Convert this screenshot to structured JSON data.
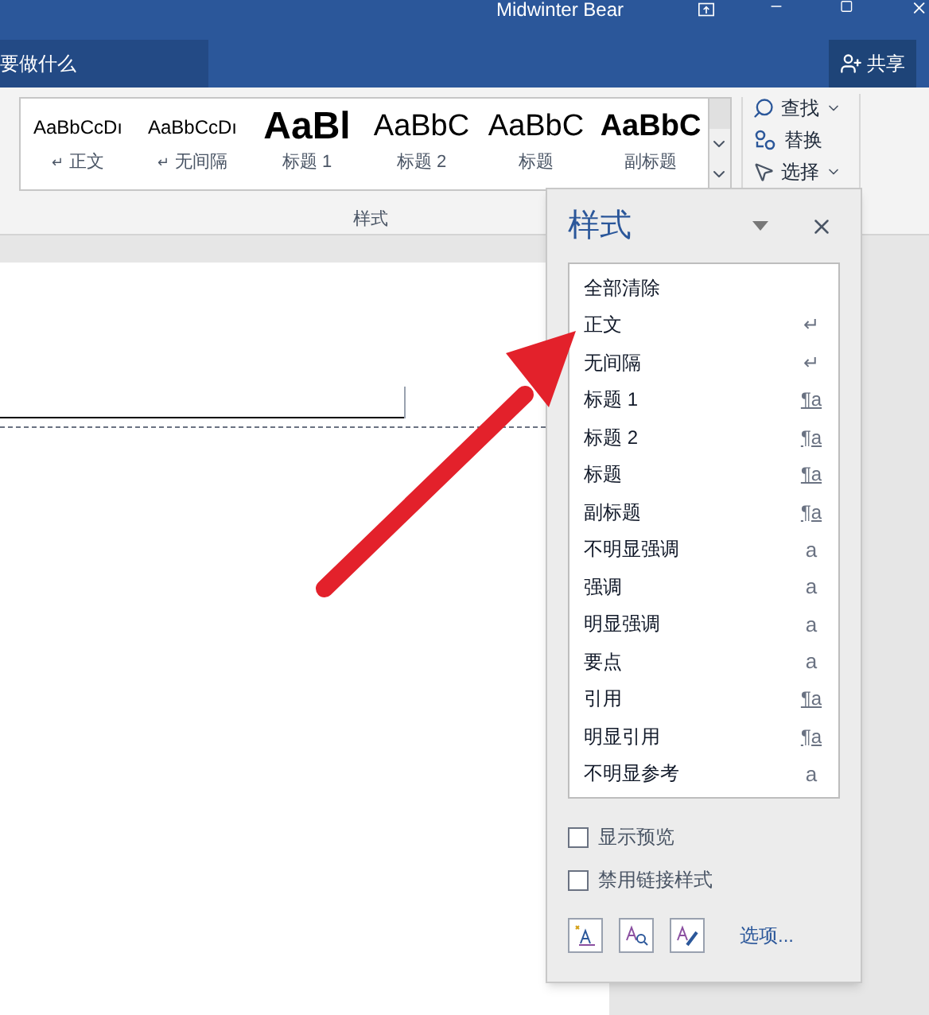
{
  "window": {
    "title": "Midwinter Bear"
  },
  "tell_me": {
    "text": "要做什么"
  },
  "share": {
    "label": "共享"
  },
  "ribbon": {
    "gallery": [
      {
        "preview": "AaBbCcDı",
        "label": "正文",
        "kind": "normal",
        "marker": "↵"
      },
      {
        "preview": "AaBbCcDı",
        "label": "无间隔",
        "kind": "normal",
        "marker": "↵"
      },
      {
        "preview": "AaBl",
        "label": "标题 1",
        "kind": "heading1"
      },
      {
        "preview": "AaBbC",
        "label": "标题 2",
        "kind": "heading2"
      },
      {
        "preview": "AaBbC",
        "label": "标题",
        "kind": "title"
      },
      {
        "preview": "AaBbC",
        "label": "副标题",
        "kind": "subtitle"
      }
    ],
    "group_label": "样式",
    "editing": [
      {
        "label": "查找",
        "kind": "find",
        "dropdown": true
      },
      {
        "label": "替换",
        "kind": "replace",
        "dropdown": false
      },
      {
        "label": "选择",
        "kind": "select",
        "dropdown": true
      }
    ]
  },
  "styles_pane": {
    "title": "样式",
    "items": [
      {
        "name": "全部清除",
        "kind": "none"
      },
      {
        "name": "正文",
        "kind": "paragraph",
        "marker": "↵"
      },
      {
        "name": "无间隔",
        "kind": "paragraph",
        "marker": "↵"
      },
      {
        "name": "标题 1",
        "kind": "linked",
        "marker": "¶a"
      },
      {
        "name": "标题 2",
        "kind": "linked",
        "marker": "¶a"
      },
      {
        "name": "标题",
        "kind": "linked",
        "marker": "¶a"
      },
      {
        "name": "副标题",
        "kind": "linked",
        "marker": "¶a"
      },
      {
        "name": "不明显强调",
        "kind": "character",
        "marker": "a"
      },
      {
        "name": "强调",
        "kind": "character",
        "marker": "a"
      },
      {
        "name": "明显强调",
        "kind": "character",
        "marker": "a"
      },
      {
        "name": "要点",
        "kind": "character",
        "marker": "a"
      },
      {
        "name": "引用",
        "kind": "linked",
        "marker": "¶a"
      },
      {
        "name": "明显引用",
        "kind": "linked",
        "marker": "¶a"
      },
      {
        "name": "不明显参考",
        "kind": "character",
        "marker": "a"
      }
    ],
    "options": [
      {
        "label": "显示预览",
        "checked": false
      },
      {
        "label": "禁用链接样式",
        "checked": false
      }
    ],
    "link": "选项..."
  }
}
